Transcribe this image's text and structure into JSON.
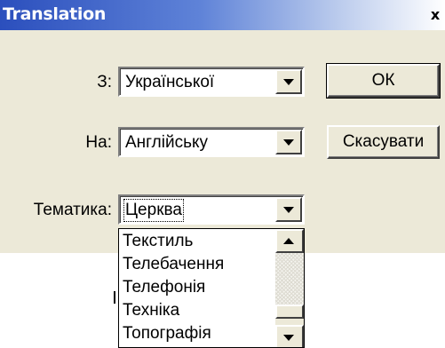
{
  "window": {
    "title": "Translation",
    "close_glyph": "x"
  },
  "form": {
    "from_label": "З:",
    "from_value": "Української",
    "to_label": "На:",
    "to_value": "Англійську",
    "topic_label": "Тематика:",
    "topic_value": "Церква"
  },
  "buttons": {
    "ok": "ОК",
    "cancel": "Скасувати"
  },
  "dropdown": {
    "items": [
      "Текстиль",
      "Телебачення",
      "Телефонія",
      "Техніка",
      "Топографія"
    ]
  },
  "icons": {
    "combo_arrow": "chevron-down-icon",
    "scroll_up": "scroll-up-icon",
    "scroll_down": "scroll-down-icon"
  },
  "colors": {
    "dialog_bg": "#ece9d8",
    "titlebar_start": "#2b4fbd",
    "titlebar_end": "#ffffff"
  }
}
